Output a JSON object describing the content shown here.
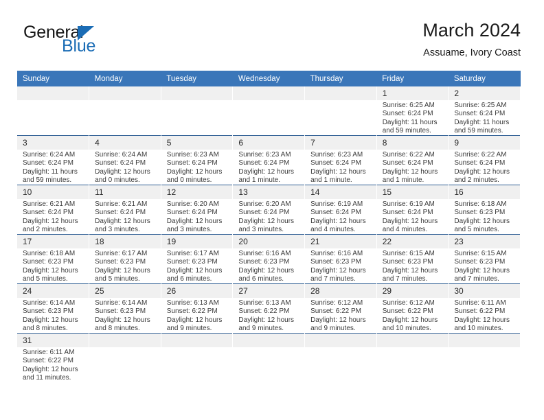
{
  "brand": {
    "name_top": "General",
    "name_bottom": "Blue",
    "accent_color": "#1a6cb5",
    "flag_icon": "triangle-flag-icon"
  },
  "header": {
    "title": "March 2024",
    "subtitle": "Assuame, Ivory Coast"
  },
  "theme": {
    "header_blue": "#3a76b9",
    "row_divider": "#2d5d93",
    "daynum_background": "#f0f0f0",
    "text": "#3a3a3a"
  },
  "calendar": {
    "weekday_headers": [
      "Sunday",
      "Monday",
      "Tuesday",
      "Wednesday",
      "Thursday",
      "Friday",
      "Saturday"
    ],
    "labels": {
      "sunrise": "Sunrise:",
      "sunset": "Sunset:",
      "daylight": "Daylight:"
    },
    "weeks": [
      [
        {
          "day": "",
          "empty": true
        },
        {
          "day": "",
          "empty": true
        },
        {
          "day": "",
          "empty": true
        },
        {
          "day": "",
          "empty": true
        },
        {
          "day": "",
          "empty": true
        },
        {
          "day": "1",
          "sunrise": "Sunrise: 6:25 AM",
          "sunset": "Sunset: 6:24 PM",
          "daylight": "Daylight: 11 hours and 59 minutes."
        },
        {
          "day": "2",
          "sunrise": "Sunrise: 6:25 AM",
          "sunset": "Sunset: 6:24 PM",
          "daylight": "Daylight: 11 hours and 59 minutes."
        }
      ],
      [
        {
          "day": "3",
          "sunrise": "Sunrise: 6:24 AM",
          "sunset": "Sunset: 6:24 PM",
          "daylight": "Daylight: 11 hours and 59 minutes."
        },
        {
          "day": "4",
          "sunrise": "Sunrise: 6:24 AM",
          "sunset": "Sunset: 6:24 PM",
          "daylight": "Daylight: 12 hours and 0 minutes."
        },
        {
          "day": "5",
          "sunrise": "Sunrise: 6:23 AM",
          "sunset": "Sunset: 6:24 PM",
          "daylight": "Daylight: 12 hours and 0 minutes."
        },
        {
          "day": "6",
          "sunrise": "Sunrise: 6:23 AM",
          "sunset": "Sunset: 6:24 PM",
          "daylight": "Daylight: 12 hours and 1 minute."
        },
        {
          "day": "7",
          "sunrise": "Sunrise: 6:23 AM",
          "sunset": "Sunset: 6:24 PM",
          "daylight": "Daylight: 12 hours and 1 minute."
        },
        {
          "day": "8",
          "sunrise": "Sunrise: 6:22 AM",
          "sunset": "Sunset: 6:24 PM",
          "daylight": "Daylight: 12 hours and 1 minute."
        },
        {
          "day": "9",
          "sunrise": "Sunrise: 6:22 AM",
          "sunset": "Sunset: 6:24 PM",
          "daylight": "Daylight: 12 hours and 2 minutes."
        }
      ],
      [
        {
          "day": "10",
          "sunrise": "Sunrise: 6:21 AM",
          "sunset": "Sunset: 6:24 PM",
          "daylight": "Daylight: 12 hours and 2 minutes."
        },
        {
          "day": "11",
          "sunrise": "Sunrise: 6:21 AM",
          "sunset": "Sunset: 6:24 PM",
          "daylight": "Daylight: 12 hours and 3 minutes."
        },
        {
          "day": "12",
          "sunrise": "Sunrise: 6:20 AM",
          "sunset": "Sunset: 6:24 PM",
          "daylight": "Daylight: 12 hours and 3 minutes."
        },
        {
          "day": "13",
          "sunrise": "Sunrise: 6:20 AM",
          "sunset": "Sunset: 6:24 PM",
          "daylight": "Daylight: 12 hours and 3 minutes."
        },
        {
          "day": "14",
          "sunrise": "Sunrise: 6:19 AM",
          "sunset": "Sunset: 6:24 PM",
          "daylight": "Daylight: 12 hours and 4 minutes."
        },
        {
          "day": "15",
          "sunrise": "Sunrise: 6:19 AM",
          "sunset": "Sunset: 6:24 PM",
          "daylight": "Daylight: 12 hours and 4 minutes."
        },
        {
          "day": "16",
          "sunrise": "Sunrise: 6:18 AM",
          "sunset": "Sunset: 6:23 PM",
          "daylight": "Daylight: 12 hours and 5 minutes."
        }
      ],
      [
        {
          "day": "17",
          "sunrise": "Sunrise: 6:18 AM",
          "sunset": "Sunset: 6:23 PM",
          "daylight": "Daylight: 12 hours and 5 minutes."
        },
        {
          "day": "18",
          "sunrise": "Sunrise: 6:17 AM",
          "sunset": "Sunset: 6:23 PM",
          "daylight": "Daylight: 12 hours and 5 minutes."
        },
        {
          "day": "19",
          "sunrise": "Sunrise: 6:17 AM",
          "sunset": "Sunset: 6:23 PM",
          "daylight": "Daylight: 12 hours and 6 minutes."
        },
        {
          "day": "20",
          "sunrise": "Sunrise: 6:16 AM",
          "sunset": "Sunset: 6:23 PM",
          "daylight": "Daylight: 12 hours and 6 minutes."
        },
        {
          "day": "21",
          "sunrise": "Sunrise: 6:16 AM",
          "sunset": "Sunset: 6:23 PM",
          "daylight": "Daylight: 12 hours and 7 minutes."
        },
        {
          "day": "22",
          "sunrise": "Sunrise: 6:15 AM",
          "sunset": "Sunset: 6:23 PM",
          "daylight": "Daylight: 12 hours and 7 minutes."
        },
        {
          "day": "23",
          "sunrise": "Sunrise: 6:15 AM",
          "sunset": "Sunset: 6:23 PM",
          "daylight": "Daylight: 12 hours and 7 minutes."
        }
      ],
      [
        {
          "day": "24",
          "sunrise": "Sunrise: 6:14 AM",
          "sunset": "Sunset: 6:23 PM",
          "daylight": "Daylight: 12 hours and 8 minutes."
        },
        {
          "day": "25",
          "sunrise": "Sunrise: 6:14 AM",
          "sunset": "Sunset: 6:23 PM",
          "daylight": "Daylight: 12 hours and 8 minutes."
        },
        {
          "day": "26",
          "sunrise": "Sunrise: 6:13 AM",
          "sunset": "Sunset: 6:22 PM",
          "daylight": "Daylight: 12 hours and 9 minutes."
        },
        {
          "day": "27",
          "sunrise": "Sunrise: 6:13 AM",
          "sunset": "Sunset: 6:22 PM",
          "daylight": "Daylight: 12 hours and 9 minutes."
        },
        {
          "day": "28",
          "sunrise": "Sunrise: 6:12 AM",
          "sunset": "Sunset: 6:22 PM",
          "daylight": "Daylight: 12 hours and 9 minutes."
        },
        {
          "day": "29",
          "sunrise": "Sunrise: 6:12 AM",
          "sunset": "Sunset: 6:22 PM",
          "daylight": "Daylight: 12 hours and 10 minutes."
        },
        {
          "day": "30",
          "sunrise": "Sunrise: 6:11 AM",
          "sunset": "Sunset: 6:22 PM",
          "daylight": "Daylight: 12 hours and 10 minutes."
        }
      ],
      [
        {
          "day": "31",
          "sunrise": "Sunrise: 6:11 AM",
          "sunset": "Sunset: 6:22 PM",
          "daylight": "Daylight: 12 hours and 11 minutes."
        },
        {
          "day": "",
          "empty": true
        },
        {
          "day": "",
          "empty": true
        },
        {
          "day": "",
          "empty": true
        },
        {
          "day": "",
          "empty": true
        },
        {
          "day": "",
          "empty": true
        },
        {
          "day": "",
          "empty": true
        }
      ]
    ]
  }
}
